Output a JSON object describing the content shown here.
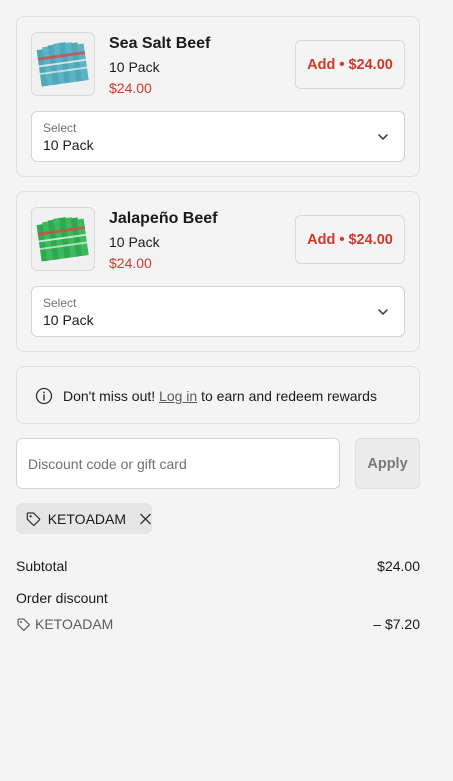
{
  "products": [
    {
      "name": "Sea Salt Beef",
      "variant": "10 Pack",
      "price": "$24.00",
      "add_label": "Add • $24.00",
      "select_label": "Select",
      "select_value": "10 Pack",
      "pack_color": "#4fa7b8",
      "image_icon": "sea-salt-beef-pack-image"
    },
    {
      "name": "Jalapeño Beef",
      "variant": "10 Pack",
      "price": "$24.00",
      "add_label": "Add • $24.00",
      "select_label": "Select",
      "select_value": "10 Pack",
      "pack_color": "#2fa84f",
      "image_icon": "jalapeno-beef-pack-image"
    }
  ],
  "notice": {
    "prefix": "Don't miss out! ",
    "link": "Log in",
    "suffix": " to earn and redeem rewards",
    "icon": "info-icon"
  },
  "discount": {
    "placeholder": "Discount code or gift card",
    "value": "",
    "apply_label": "Apply",
    "applied_code": "KETOADAM"
  },
  "summary": {
    "subtotal_label": "Subtotal",
    "subtotal_value": "$24.00",
    "order_discount_label": "Order discount",
    "discount_code": "KETOADAM",
    "discount_value": "– $7.20"
  },
  "colors": {
    "price_red": "#d2372b",
    "background": "#f4f4f4"
  }
}
